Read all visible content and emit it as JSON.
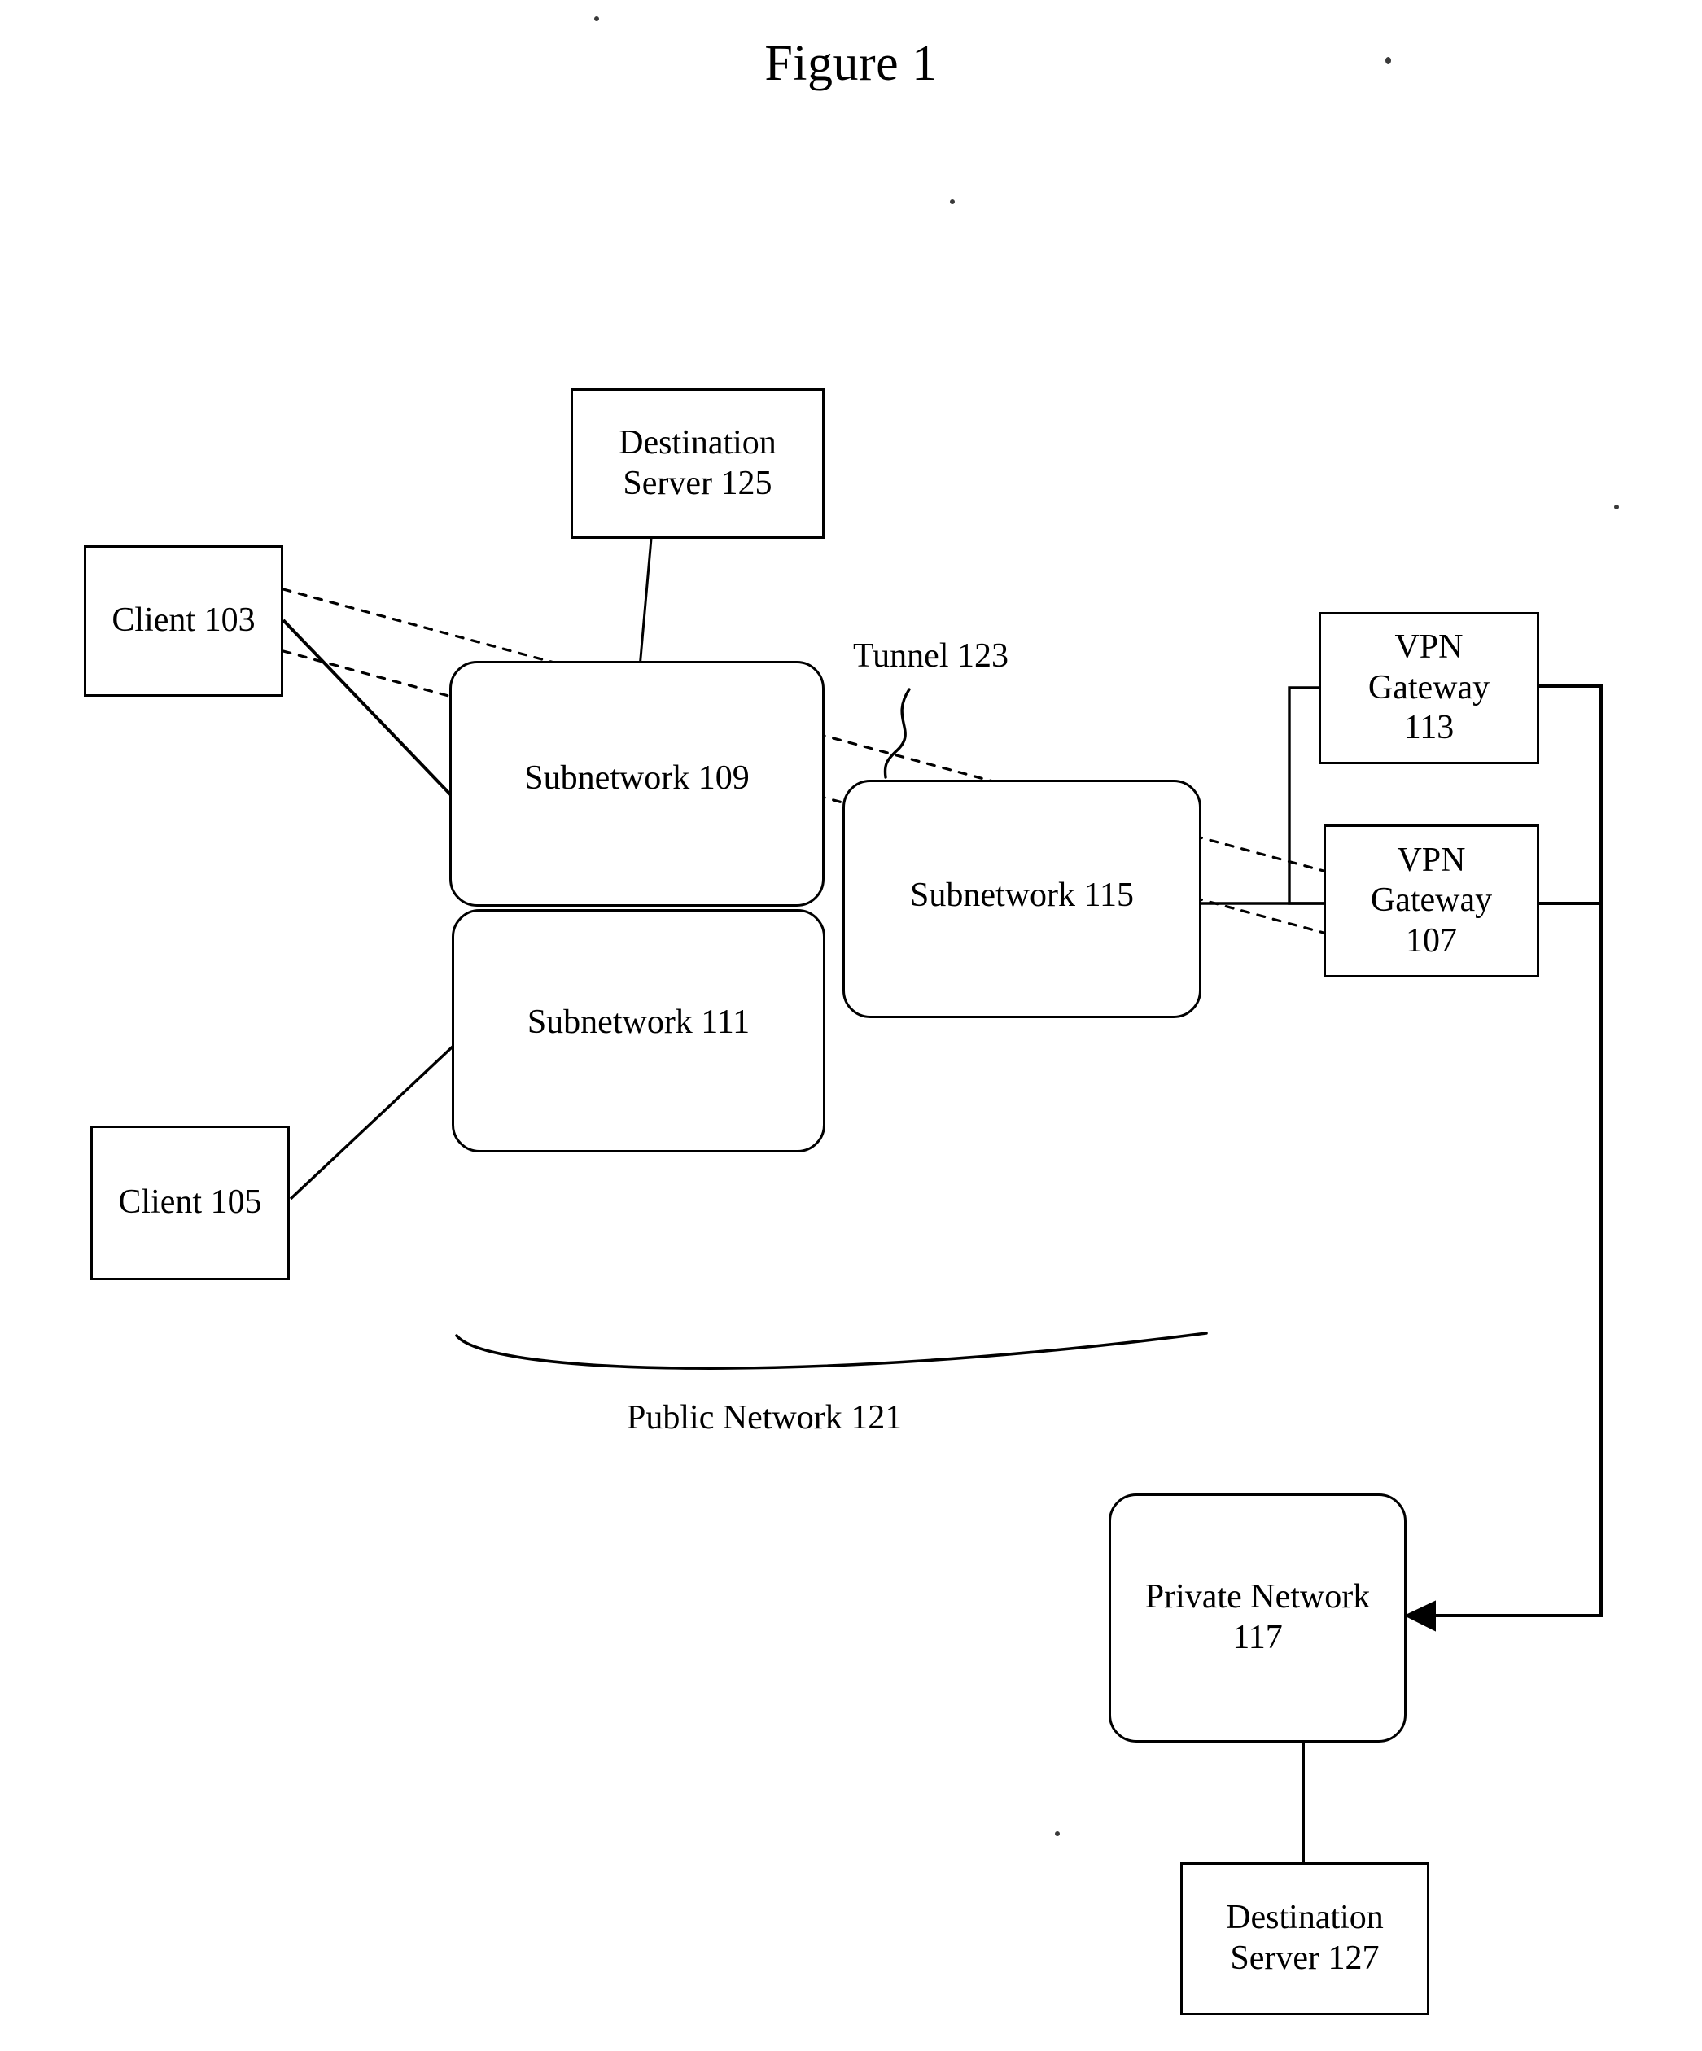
{
  "figure": {
    "title": "Figure 1"
  },
  "nodes": {
    "destination_server_125": {
      "label": "Destination\nServer 125"
    },
    "client_103": {
      "label": "Client 103"
    },
    "client_105": {
      "label": "Client 105"
    },
    "vpn_gateway_113": {
      "label": "VPN\nGateway\n113"
    },
    "vpn_gateway_107": {
      "label": "VPN\nGateway\n107"
    },
    "subnetwork_109": {
      "label": "Subnetwork 109"
    },
    "subnetwork_111": {
      "label": "Subnetwork 111"
    },
    "subnetwork_115": {
      "label": "Subnetwork 115"
    },
    "private_network_117": {
      "label": "Private Network 117"
    },
    "destination_server_127": {
      "label": "Destination\nServer 127"
    }
  },
  "annotations": {
    "tunnel_123": {
      "label": "Tunnel 123"
    },
    "public_network_121": {
      "label": "Public Network 121"
    }
  },
  "style": {
    "line_color": "#000000",
    "background": "#ffffff"
  },
  "diagram_data": {
    "type": "network-block-diagram",
    "reference_numerals": [
      103,
      105,
      107,
      109,
      111,
      113,
      115,
      117,
      121,
      123,
      125,
      127
    ],
    "connections": [
      {
        "from": "client_103",
        "to": "vpn_gateway_107",
        "style": "dashed",
        "meaning": "tunnel"
      },
      {
        "from": "client_103",
        "to": "vpn_gateway_107",
        "style": "dashed",
        "meaning": "tunnel"
      },
      {
        "from": "client_103",
        "to": "subnetwork_109",
        "style": "solid"
      },
      {
        "from": "client_105",
        "to": "subnetwork_111",
        "style": "solid"
      },
      {
        "from": "destination_server_125",
        "to": "subnetwork_109",
        "style": "solid"
      },
      {
        "from": "subnetwork_115",
        "to": "vpn_gateway_107",
        "style": "solid"
      },
      {
        "from": "vpn_gateway_113",
        "to": "subnetwork_115",
        "style": "solid"
      },
      {
        "from": "vpn_gateway_113",
        "to": "private_network_117",
        "style": "solid",
        "arrow": true
      },
      {
        "from": "vpn_gateway_107",
        "to": "private_network_117",
        "style": "solid",
        "arrow": true
      },
      {
        "from": "private_network_117",
        "to": "destination_server_127",
        "style": "solid"
      }
    ],
    "grouping": {
      "public_network_121": [
        "subnetwork_109",
        "subnetwork_111",
        "subnetwork_115"
      ]
    }
  }
}
